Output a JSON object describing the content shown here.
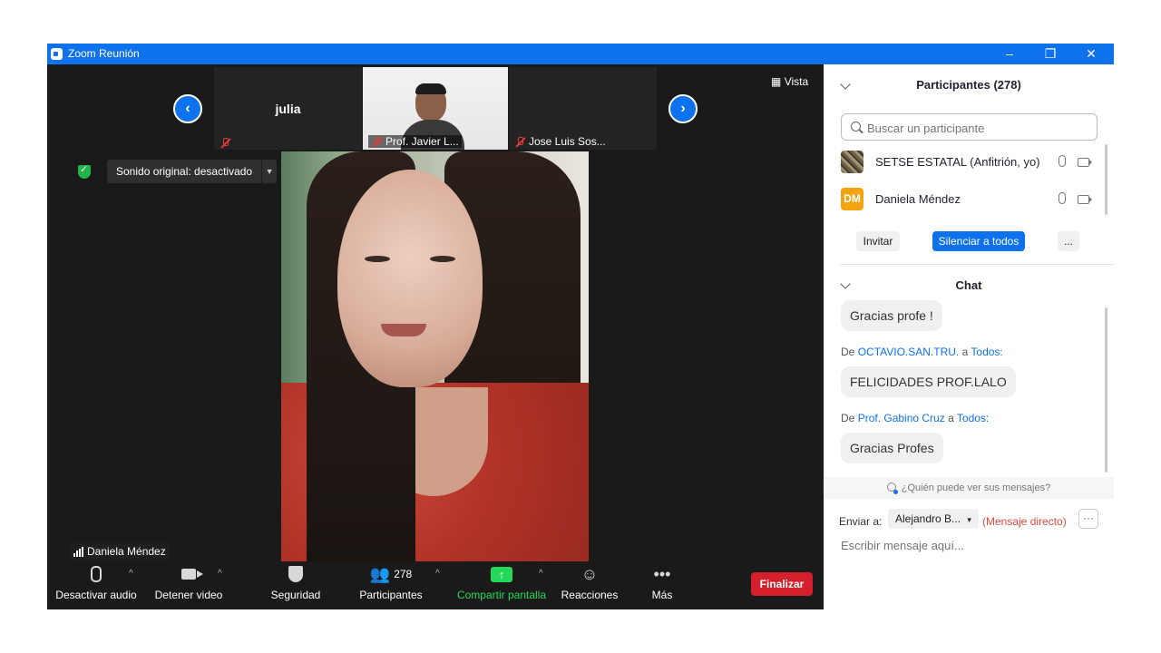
{
  "window": {
    "title": "Zoom Reunión",
    "controls": [
      "–",
      "❐",
      "✕"
    ]
  },
  "top_bar": {
    "view_label": "Vista",
    "thumbnails": [
      {
        "name": "julia",
        "label": ""
      },
      {
        "name": "",
        "label": "Prof. Javier L..."
      },
      {
        "name": "",
        "label": "Jose Luis Sos..."
      }
    ]
  },
  "sound": {
    "label": "Sonido original: desactivado"
  },
  "main_video": {
    "speaker_name": "Daniela Méndez"
  },
  "toolbar": {
    "mute": "Desactivar audio",
    "stop_video": "Detener video",
    "security": "Seguridad",
    "participants": "Participantes",
    "participants_count": "278",
    "share": "Compartir pantalla",
    "reactions": "Reacciones",
    "more": "Más",
    "end": "Finalizar"
  },
  "participants_panel": {
    "title": "Participantes (278)",
    "search_placeholder": "Buscar un participante",
    "items": [
      {
        "name": "SETSE ESTATAL (Anfitrión, yo)",
        "initials": ""
      },
      {
        "name": "Daniela Méndez",
        "initials": "DM"
      }
    ],
    "invite": "Invitar",
    "mute_all": "Silenciar a todos",
    "more": "..."
  },
  "chat": {
    "title": "Chat",
    "messages": [
      {
        "text": "Gracias profe !"
      },
      {
        "de": "De",
        "sender": "OCTAVIO.SAN.TRU.",
        "a": "a",
        "to": "Todos:",
        "text": "FELICIDADES PROF.LALO"
      },
      {
        "de": "De",
        "sender": "Prof. Gabino Cruz",
        "a": "a",
        "to": "Todos:",
        "text": "Gracias Profes"
      }
    ],
    "who_can_see": "¿Quién puede ver sus mensajes?",
    "send_to_label": "Enviar a:",
    "recipient": "Alejandro B...",
    "direct_label": "(Mensaje directo)",
    "more": "···",
    "input_placeholder": "Escribir mensaje aquí..."
  },
  "colors": {
    "zoom_blue": "#0e72ed",
    "end_red": "#d3202c",
    "share_green": "#23d959"
  }
}
